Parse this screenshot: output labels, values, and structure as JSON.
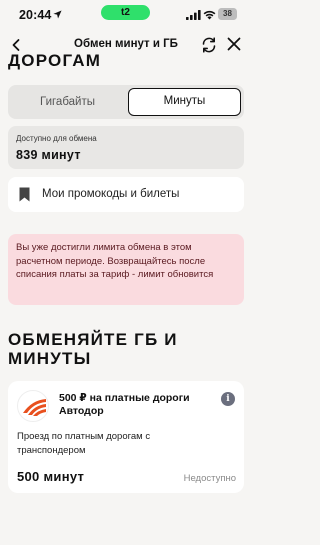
{
  "status_bar": {
    "time": "20:44",
    "carrier": "t2",
    "battery": "38"
  },
  "header": {
    "title": "Обмен минут и ГБ"
  },
  "clipped_heading": "ДОРОГАМ",
  "tabs": [
    {
      "label": "Гигабайты",
      "selected": false
    },
    {
      "label": "Минуты",
      "selected": true
    }
  ],
  "available": {
    "label": "Доступно для обмена",
    "value": "839 минут"
  },
  "promo": {
    "label": "Мои промокоды и билеты"
  },
  "alert": {
    "text": "Вы уже достигли лимита обмена в этом расчетном периоде. Возвращайтесь после списания платы за тариф - лимит обновится"
  },
  "section": {
    "title": "ОБМЕНЯЙТЕ ГБ И МИНУТЫ"
  },
  "offer": {
    "title": "500 ₽ на платные дороги Автодор",
    "description": "Проезд по платным дорогам с транспондером",
    "cost": "500 минут",
    "status": "Недоступно",
    "info_icon": "i"
  },
  "colors": {
    "background": "#f6f5f3",
    "carrier_badge": "#2fe06b",
    "alert_bg": "#fadbdf",
    "logo_accent": "#e8501e"
  }
}
